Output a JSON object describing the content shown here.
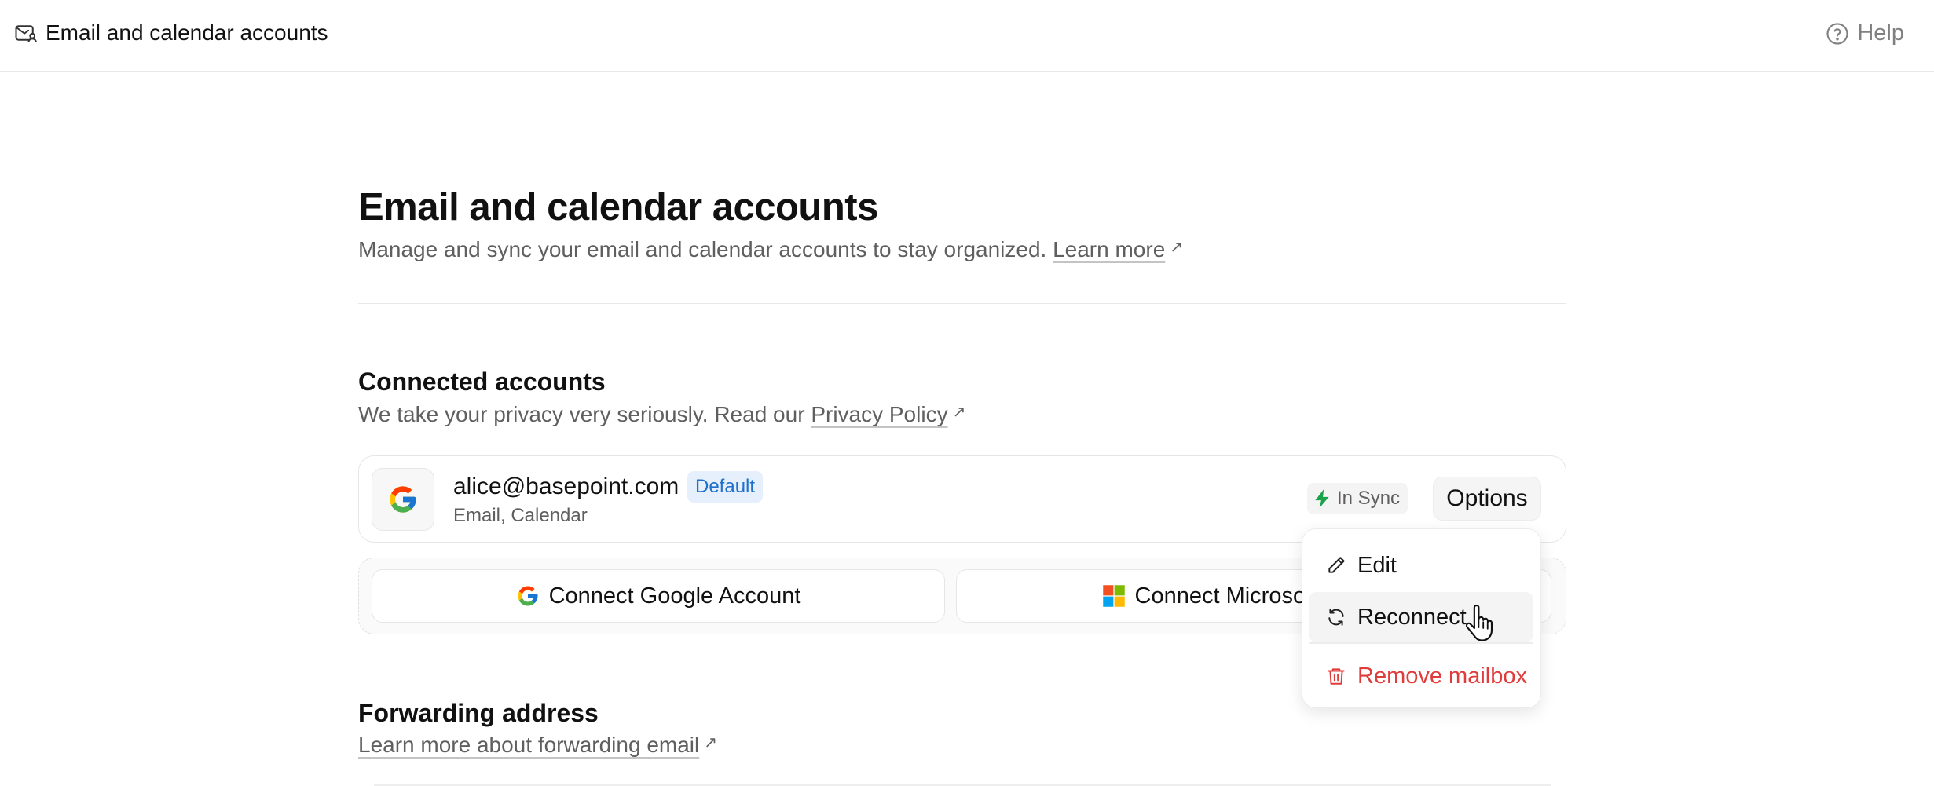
{
  "topbar": {
    "title": "Email and calendar accounts",
    "help_label": "Help"
  },
  "header": {
    "title": "Email and calendar accounts",
    "subtitle": "Manage and sync your email and calendar accounts to stay organized.",
    "learn_more": "Learn more"
  },
  "connected": {
    "title": "Connected accounts",
    "subtitle": "We take your privacy very seriously. Read our",
    "privacy_link": "Privacy Policy",
    "account": {
      "email": "alice@basepoint.com",
      "badge": "Default",
      "services": "Email, Calendar",
      "sync_status": "In Sync",
      "options_label": "Options"
    },
    "connect_google": "Connect Google Account",
    "connect_microsoft": "Connect Microsoft Account"
  },
  "forwarding": {
    "title": "Forwarding address",
    "link": "Learn more about forwarding email"
  },
  "menu": {
    "edit": "Edit",
    "reconnect": "Reconnect",
    "remove": "Remove mailbox"
  },
  "colors": {
    "accent_blue": "#1f6fcc",
    "danger_red": "#e03c3c",
    "sync_green": "#1aa34a"
  },
  "icons": [
    "mailbox-icon",
    "help-icon",
    "google-icon",
    "bolt-icon",
    "microsoft-icon",
    "pencil-icon",
    "refresh-icon",
    "trash-icon",
    "external-link-icon",
    "pointer-cursor-icon"
  ]
}
